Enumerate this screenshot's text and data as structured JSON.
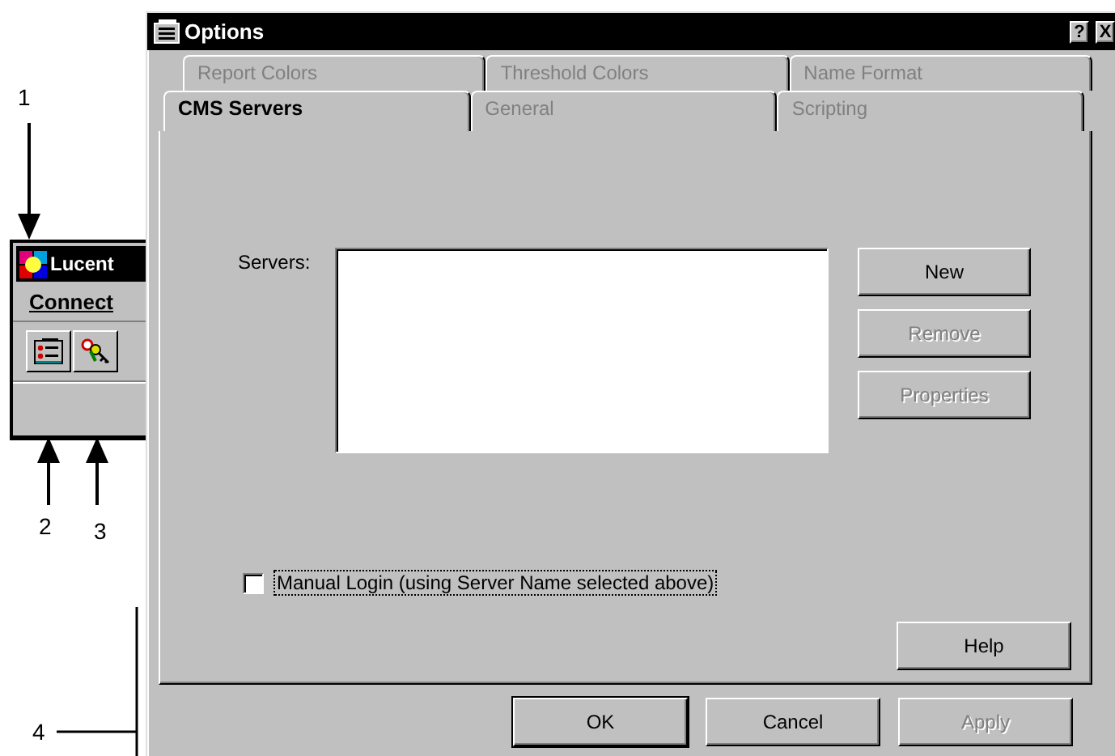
{
  "callouts": [
    {
      "label": "1"
    },
    {
      "label": "2"
    },
    {
      "label": "3"
    },
    {
      "label": "4"
    }
  ],
  "app_window": {
    "title": "Lucent",
    "menu": [
      "Connect"
    ]
  },
  "dialog": {
    "title": "Options",
    "title_buttons": [
      "?",
      "X"
    ],
    "tab_rows": [
      [
        {
          "label": "Report Colors",
          "selected": false
        },
        {
          "label": "Threshold Colors",
          "selected": false
        },
        {
          "label": "Name Format",
          "selected": false
        }
      ],
      [
        {
          "label": "CMS Servers",
          "selected": true
        },
        {
          "label": "General",
          "selected": false
        },
        {
          "label": "Scripting",
          "selected": false
        }
      ]
    ],
    "servers": {
      "label": "Servers:"
    },
    "side_buttons": [
      {
        "label": "New",
        "disabled": false
      },
      {
        "label": "Remove",
        "disabled": true
      },
      {
        "label": "Properties",
        "disabled": true
      }
    ],
    "checkbox": {
      "label": "Manual Login (using Server Name selected above)",
      "checked": false,
      "focused": true
    },
    "help_button": {
      "label": "Help",
      "disabled": false
    },
    "footer_buttons": [
      {
        "label": "OK",
        "disabled": false,
        "default": true
      },
      {
        "label": "Cancel",
        "disabled": false,
        "default": false
      },
      {
        "label": "Apply",
        "disabled": true,
        "default": false
      }
    ]
  }
}
